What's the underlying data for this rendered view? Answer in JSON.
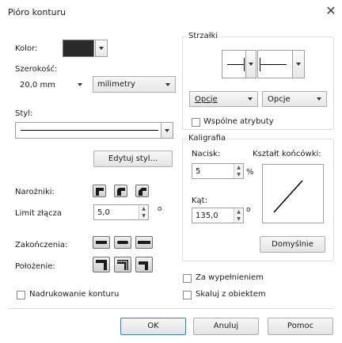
{
  "dialog": {
    "title": "Pióro konturu"
  },
  "left": {
    "color_label": "Kolor:",
    "color_value": "#2b2b2b",
    "width_label": "Szerokość:",
    "width_value": "20,0 mm",
    "unit_value": "milimetry",
    "style_label": "Styl:",
    "edit_style_button": "Edytuj styl...",
    "corners_label": "Narożniki:",
    "miter_label": "Limit złącza",
    "miter_value": "5,0",
    "miter_unit": "o",
    "ends_label": "Zakończenia:",
    "position_label": "Położenie:",
    "overprint_label": "Nadrukowanie konturu"
  },
  "arrows": {
    "group_label": "Strzałki",
    "options_left": "Opcje",
    "options_right_pre": "Opc",
    "options_right_u": "j",
    "options_right_post": "e",
    "shared_attrs_label": "Wspólne atrybuty"
  },
  "calligraphy": {
    "group_label": "Kaligrafia",
    "stretch_label": "Nacisk:",
    "stretch_value": "5",
    "stretch_unit": "%",
    "nib_label": "Kształt końcówki:",
    "angle_label": "Kąt:",
    "angle_value": "135,0",
    "angle_unit": "o",
    "default_button": "Domyślnie"
  },
  "options": {
    "behind_fill_label": "Za wypełnieniem",
    "scale_label": "Skaluj z obiektem"
  },
  "footer": {
    "ok": "OK",
    "cancel": "Anuluj",
    "help": "Pomoc"
  }
}
